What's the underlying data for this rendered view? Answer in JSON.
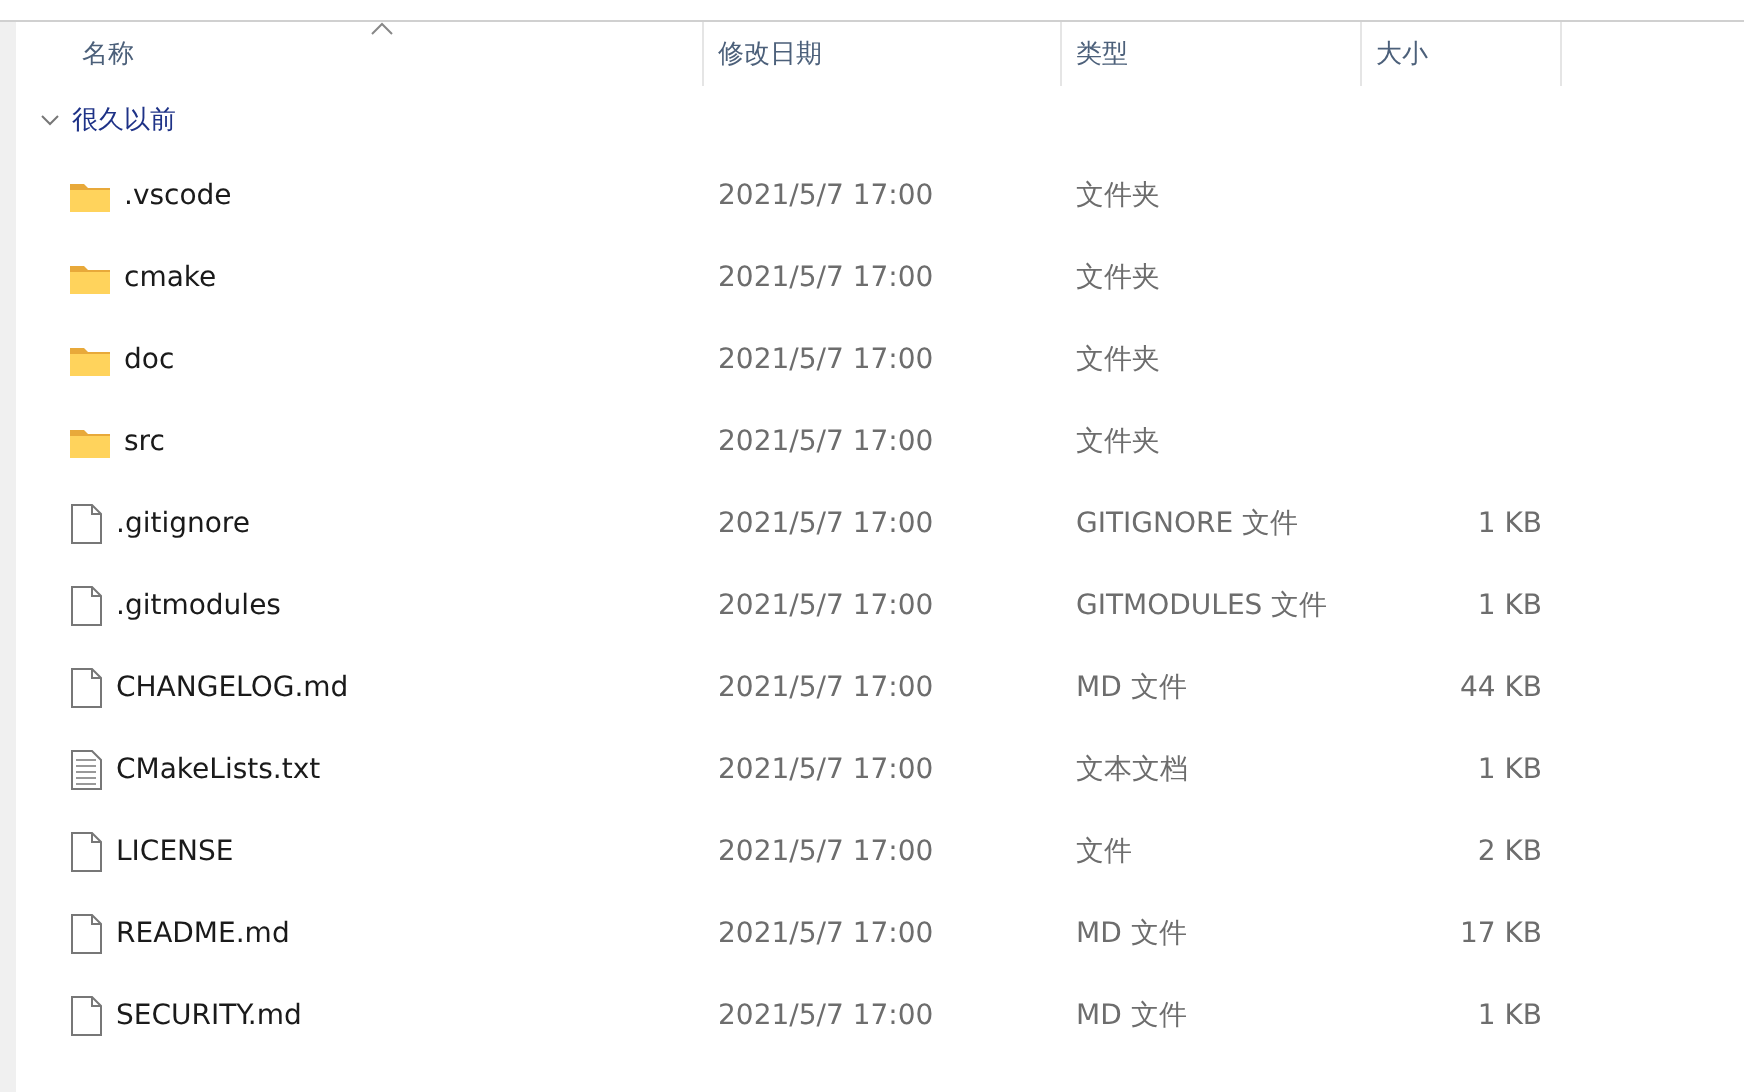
{
  "columns": [
    {
      "label": "名称",
      "sorted": true
    },
    {
      "label": "修改日期",
      "sorted": false
    },
    {
      "label": "类型",
      "sorted": false
    },
    {
      "label": "大小",
      "sorted": false
    }
  ],
  "group": {
    "label": "很久以前",
    "expanded": true
  },
  "rows": [
    {
      "kind": "folder",
      "name": ".vscode",
      "date": "2021/5/7 17:00",
      "type": "文件夹"
    },
    {
      "kind": "folder",
      "name": "cmake",
      "date": "2021/5/7 17:00",
      "type": "文件夹"
    },
    {
      "kind": "folder",
      "name": "doc",
      "date": "2021/5/7 17:00",
      "type": "文件夹"
    },
    {
      "kind": "folder",
      "name": "src",
      "date": "2021/5/7 17:00",
      "type": "文件夹"
    },
    {
      "kind": "file",
      "name": ".gitignore",
      "date": "2021/5/7 17:00",
      "type": "GITIGNORE 文件",
      "size": "1 KB"
    },
    {
      "kind": "file",
      "name": ".gitmodules",
      "date": "2021/5/7 17:00",
      "type": "GITMODULES 文件",
      "size": "1 KB"
    },
    {
      "kind": "file",
      "name": "CHANGELOG.md",
      "date": "2021/5/7 17:00",
      "type": "MD 文件",
      "size": "44 KB"
    },
    {
      "kind": "text",
      "name": "CMakeLists.txt",
      "date": "2021/5/7 17:00",
      "type": "文本文档",
      "size": "1 KB"
    },
    {
      "kind": "file",
      "name": "LICENSE",
      "date": "2021/5/7 17:00",
      "type": "文件",
      "size": "2 KB"
    },
    {
      "kind": "file",
      "name": "README.md",
      "date": "2021/5/7 17:00",
      "type": "MD 文件",
      "size": "17 KB"
    },
    {
      "kind": "file",
      "name": "SECURITY.md",
      "date": "2021/5/7 17:00",
      "type": "MD 文件",
      "size": "1 KB"
    }
  ]
}
